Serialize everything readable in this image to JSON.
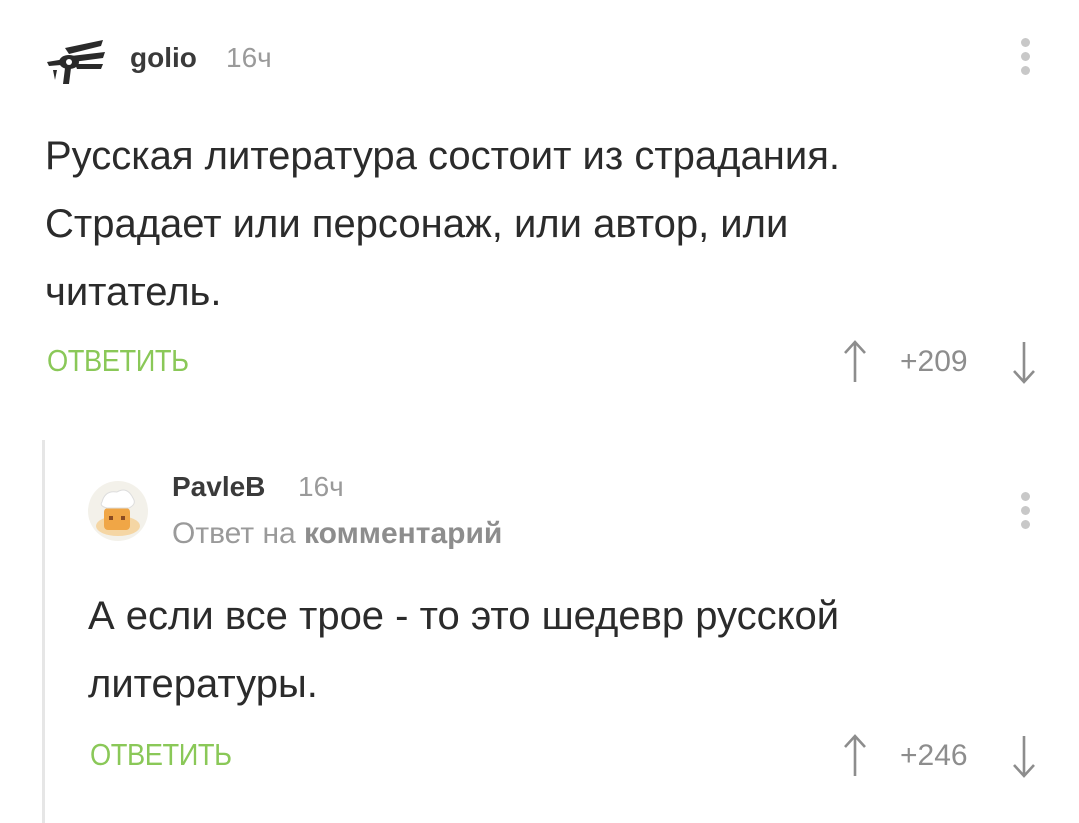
{
  "comment1": {
    "username": "golio",
    "time": "16ч",
    "text_line1": "Русская литература состоит из страдания.",
    "text_line2": "Страдает или персонаж, или автор, или",
    "text_line3": "читатель.",
    "reply_label": "ОТВЕТИТЬ",
    "score": "+209"
  },
  "comment2": {
    "username": "PavleB",
    "time": "16ч",
    "reply_to_prefix": "Ответ на",
    "reply_to_link": "комментарий",
    "text_line1": "А если все трое - то это шедевр русской",
    "text_line2": "литературы.",
    "reply_label": "ОТВЕТИТЬ",
    "score": "+246"
  },
  "colors": {
    "accent_green": "#8ac858",
    "muted_gray": "#8d8d8d",
    "thread_line": "#e6e6e6"
  },
  "icons": {
    "avatar1": "winged-eye-logo",
    "avatar2": "chef-avatar",
    "menu": "vertical-dots-icon",
    "upvote": "arrow-up-icon",
    "downvote": "arrow-down-icon"
  }
}
